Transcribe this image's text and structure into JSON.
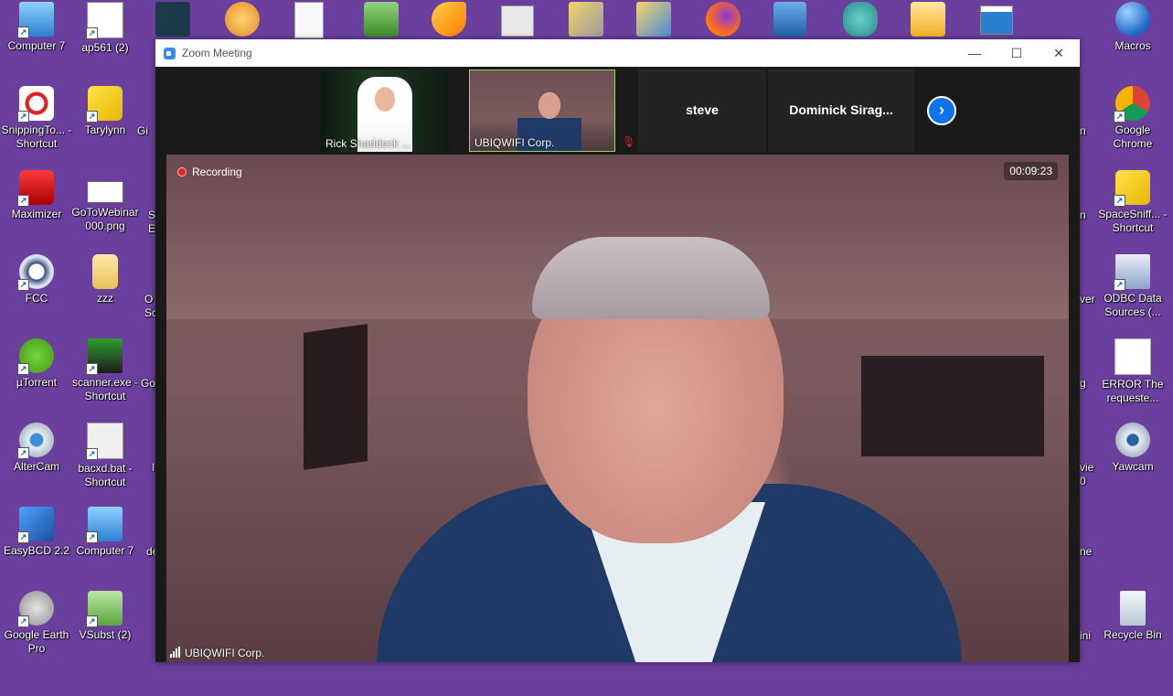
{
  "desktop": {
    "left_icons": [
      {
        "label": "Computer 7",
        "icon": "computer-icon"
      },
      {
        "label": "ap561 (2)",
        "icon": "document-icon"
      },
      {
        "label": "SnippingTo... - Shortcut",
        "icon": "snipping-tool-icon"
      },
      {
        "label": "Tarylynn",
        "icon": "network-icon"
      },
      {
        "label": "Maximizer",
        "icon": "maximizer-icon"
      },
      {
        "label": "GoToWebinar 000.png",
        "icon": "image-file-icon"
      },
      {
        "label": "FCC",
        "icon": "phone-icon"
      },
      {
        "label": "zzz",
        "icon": "folder-icon"
      },
      {
        "label": "µTorrent",
        "icon": "utorrent-icon"
      },
      {
        "label": "scanner.exe - Shortcut",
        "icon": "scanner-icon"
      },
      {
        "label": "AlterCam",
        "icon": "webcam-icon"
      },
      {
        "label": "bacxd.bat - Shortcut",
        "icon": "batch-file-icon"
      },
      {
        "label": "EasyBCD 2.2",
        "icon": "easybcd-icon"
      },
      {
        "label": "Computer 7",
        "icon": "computer-icon"
      },
      {
        "label": "Google Earth Pro",
        "icon": "google-earth-icon"
      },
      {
        "label": "VSubst (2)",
        "icon": "vsubst-icon"
      }
    ],
    "partial_labels": [
      "Gi",
      "S",
      "E",
      "O",
      "Sc",
      "Go",
      "I",
      "de"
    ],
    "right_partial_labels": [
      "n",
      "n",
      "ver",
      "g",
      "vie",
      "0",
      "ne",
      "ini"
    ],
    "right_icons": [
      {
        "label": "Macros",
        "icon": "globe-icon"
      },
      {
        "label": "Google Chrome",
        "icon": "chrome-icon"
      },
      {
        "label": "SpaceSniff... - Shortcut",
        "icon": "puzzle-icon"
      },
      {
        "label": "ODBC Data Sources (...",
        "icon": "odbc-icon"
      },
      {
        "label": "ERROR The requeste...",
        "icon": "error-image-icon"
      },
      {
        "label": "Yawcam",
        "icon": "webcam-icon"
      },
      {
        "label": "Recycle Bin",
        "icon": "recycle-bin-icon"
      }
    ],
    "top_row_icons": [
      "app-icon",
      "paint-icon",
      "document-icon",
      "installer-icon",
      "fox-icon",
      "settings-icon",
      "tools-icon",
      "tools-icon",
      "firefox-icon",
      "virtualbox-icon",
      "tree-icon",
      "outlook-icon",
      "window-icon"
    ]
  },
  "zoom": {
    "title": "Zoom Meeting",
    "controls": {
      "minimize": "—",
      "maximize": "☐",
      "close": "✕"
    },
    "participants": [
      {
        "name": "Rick Shaddock ...",
        "type": "video"
      },
      {
        "name": "UBIQWIFI Corp.",
        "type": "video",
        "active": true,
        "muted": true
      },
      {
        "name": "steve",
        "type": "name"
      },
      {
        "name": "Dominick  Sirag...",
        "type": "name"
      }
    ],
    "next_icon": "›",
    "recording_label": "Recording",
    "timer": "00:09:23",
    "speaker_name": "UBIQWIFI Corp."
  }
}
